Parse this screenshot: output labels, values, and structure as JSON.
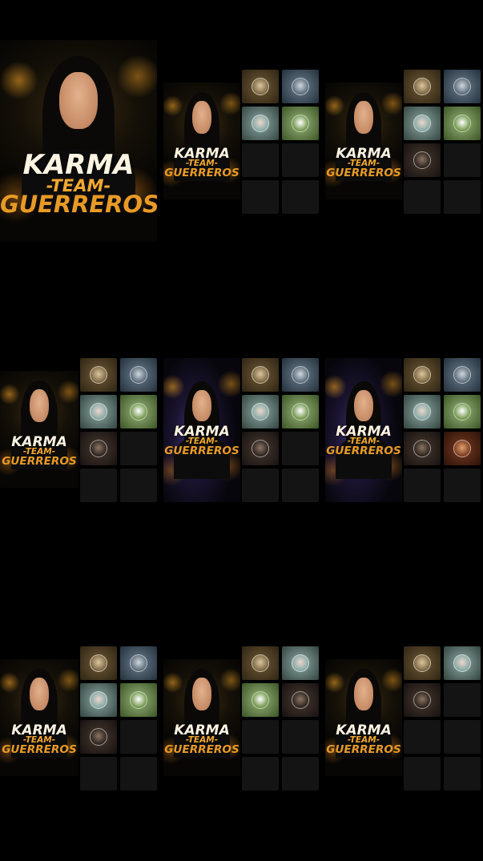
{
  "logo": {
    "line1": "KARMA",
    "line2": "-TEAM-",
    "line3": "GUERREROS"
  },
  "colors": {
    "background": "#000000",
    "slot_empty": "#141414",
    "accent": "#f2a830"
  },
  "panels": [
    {
      "id": "p1",
      "style": "gold",
      "slots": []
    },
    {
      "id": "p2",
      "style": "gold",
      "slots": [
        "tan",
        "steel",
        "mint",
        "green",
        "empty",
        "empty",
        "empty",
        "empty"
      ]
    },
    {
      "id": "p3",
      "style": "gold",
      "slots": [
        "tan",
        "steel",
        "mint",
        "green",
        "dark",
        "empty",
        "empty",
        "empty"
      ]
    },
    {
      "id": "p4",
      "style": "gold",
      "slots": [
        "tan",
        "steel",
        "mint",
        "green",
        "dark",
        "empty",
        "empty",
        "empty"
      ]
    },
    {
      "id": "p5",
      "style": "purple",
      "slots": [
        "tan",
        "steel",
        "mint",
        "green",
        "dark",
        "empty",
        "empty",
        "empty"
      ]
    },
    {
      "id": "p6",
      "style": "purple",
      "slots": [
        "tan",
        "steel",
        "mint",
        "green",
        "dark",
        "red",
        "empty",
        "empty"
      ]
    },
    {
      "id": "p7",
      "style": "gold",
      "slots": [
        "tan",
        "steel",
        "mint",
        "green",
        "dark",
        "empty",
        "empty",
        "empty"
      ]
    },
    {
      "id": "p8",
      "style": "gold",
      "slots": [
        "tan",
        "mint",
        "green",
        "dark",
        "empty",
        "empty",
        "empty",
        "empty"
      ]
    },
    {
      "id": "p9",
      "style": "gold",
      "slots": [
        "tan",
        "mint",
        "dark",
        "empty",
        "empty",
        "empty",
        "empty",
        "empty"
      ]
    }
  ]
}
